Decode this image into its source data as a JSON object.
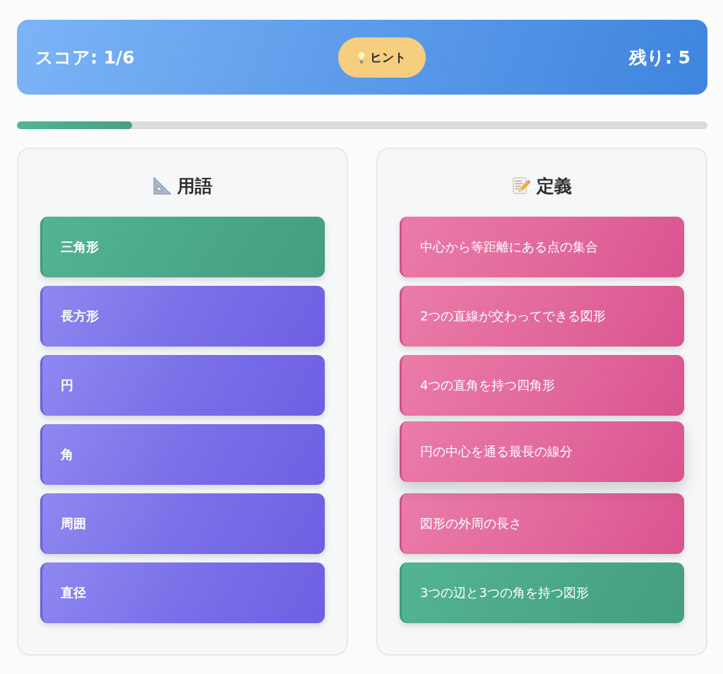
{
  "header": {
    "score": "スコア: 1/6",
    "hint_button": "ヒント",
    "remaining": "残り: 5"
  },
  "progress": {
    "level": 0.1667
  },
  "panels": [
    {
      "kind": "terms",
      "title": "用語",
      "items": [
        {
          "text": "三角形",
          "matched": true,
          "hovered": false
        },
        {
          "text": "長方形",
          "matched": false,
          "hovered": false
        },
        {
          "text": "円",
          "matched": false,
          "hovered": false
        },
        {
          "text": "角",
          "matched": false,
          "hovered": false
        },
        {
          "text": "周囲",
          "matched": false,
          "hovered": false
        },
        {
          "text": "直径",
          "matched": false,
          "hovered": false
        }
      ]
    },
    {
      "kind": "definitions",
      "title": "定義",
      "items": [
        {
          "text": "中心から等距離にある点の集合",
          "matched": false,
          "hovered": false
        },
        {
          "text": "2つの直線が交わってできる図形",
          "matched": false,
          "hovered": false
        },
        {
          "text": "4つの直角を持つ四角形",
          "matched": false,
          "hovered": false
        },
        {
          "text": "円の中心を通る最長の線分",
          "matched": false,
          "hovered": true
        },
        {
          "text": "図形の外周の長さ",
          "matched": false,
          "hovered": false
        },
        {
          "text": "3つの辺と3つの角を持つ図形",
          "matched": true,
          "hovered": false
        }
      ]
    }
  ]
}
